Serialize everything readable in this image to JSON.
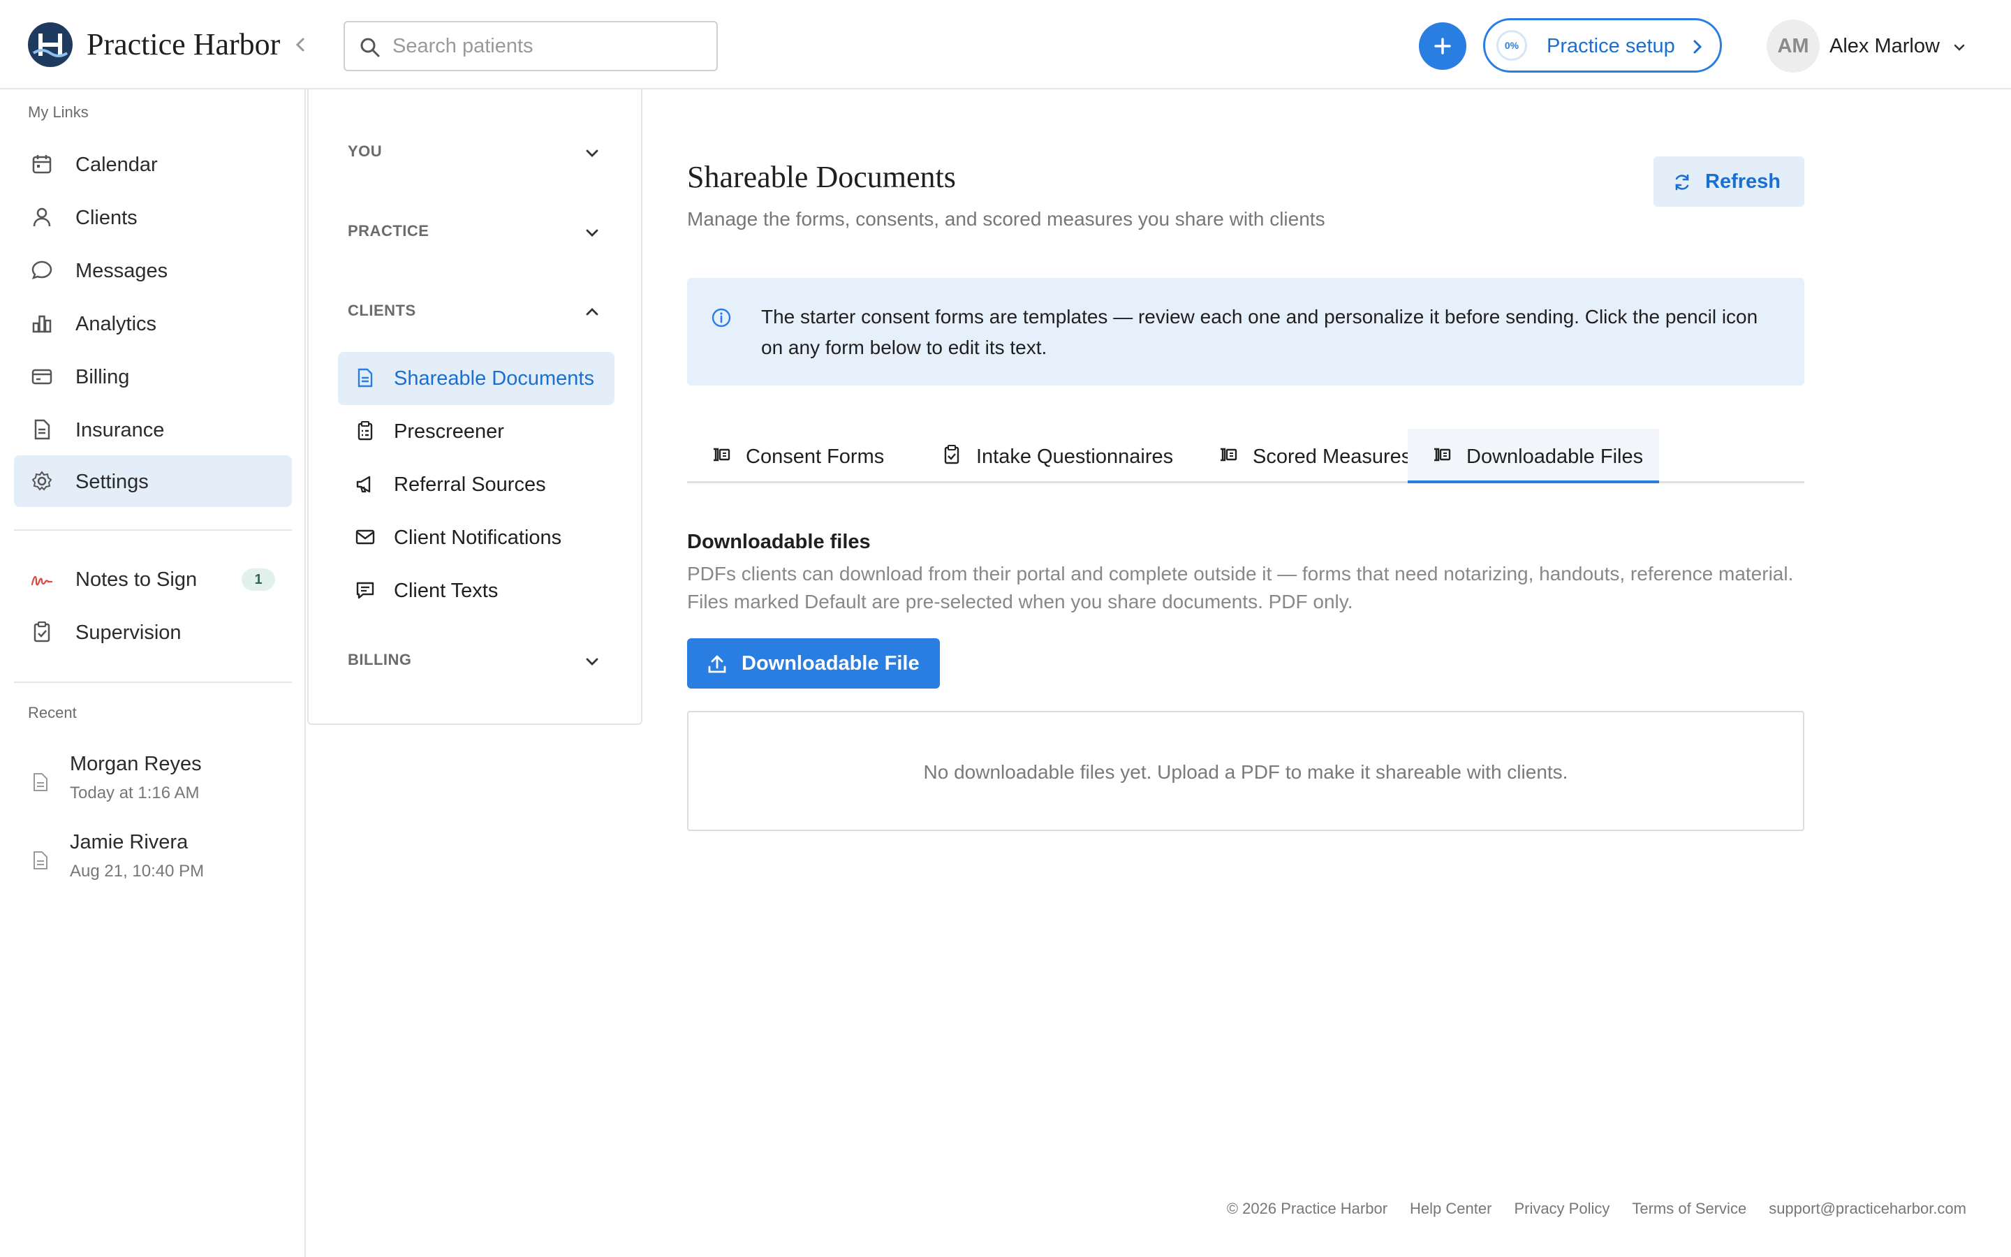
{
  "app": {
    "brand": "Practice Harbor"
  },
  "header": {
    "search_placeholder": "Search patients",
    "setup_progress": "0%",
    "setup_label": "Practice setup",
    "user_initials": "AM",
    "user_name": "Alex Marlow"
  },
  "sidebar": {
    "my_links_heading": "My Links",
    "items": [
      {
        "label": "Calendar",
        "icon": "calendar-icon"
      },
      {
        "label": "Clients",
        "icon": "user-icon"
      },
      {
        "label": "Messages",
        "icon": "chat-bubble-icon"
      },
      {
        "label": "Analytics",
        "icon": "bar-chart-icon"
      },
      {
        "label": "Billing",
        "icon": "credit-card-icon"
      },
      {
        "label": "Insurance",
        "icon": "document-icon"
      },
      {
        "label": "Settings",
        "icon": "gear-icon"
      }
    ],
    "secondary_items": [
      {
        "label": "Notes to Sign",
        "icon": "signature-icon",
        "badge": "1"
      },
      {
        "label": "Supervision",
        "icon": "clipboard-check-icon"
      }
    ],
    "recent_heading": "Recent",
    "recent": [
      {
        "name": "Morgan Reyes",
        "time": "Today at 1:16 AM"
      },
      {
        "name": "Jamie Rivera",
        "time": "Aug 21, 10:40 PM"
      }
    ]
  },
  "subnav": {
    "sections": [
      "YOU",
      "PRACTICE",
      "CLIENTS",
      "BILLING"
    ],
    "client_items": [
      {
        "label": "Shareable Documents",
        "icon": "document-icon"
      },
      {
        "label": "Prescreener",
        "icon": "clipboard-icon"
      },
      {
        "label": "Referral Sources",
        "icon": "megaphone-icon"
      },
      {
        "label": "Client Notifications",
        "icon": "envelope-icon"
      },
      {
        "label": "Client Texts",
        "icon": "message-icon"
      }
    ]
  },
  "main": {
    "title": "Shareable Documents",
    "subtitle": "Manage the forms, consents, and scored measures you share with clients",
    "refresh_label": "Refresh",
    "info_text": "The starter consent forms are templates — review each one and personalize it before sending. Click the pencil icon on any form below to edit its text.",
    "tabs": [
      {
        "label": "Consent Forms",
        "icon": "form-icon"
      },
      {
        "label": "Intake Questionnaires",
        "icon": "clipboard-icon"
      },
      {
        "label": "Scored Measures",
        "icon": "form-icon"
      },
      {
        "label": "Downloadable Files",
        "icon": "form-icon"
      }
    ],
    "active_tab": "Downloadable Files",
    "section_title": "Downloadable files",
    "section_desc": "PDFs clients can download from their portal and complete outside it — forms that need notarizing, handouts, reference material. Files marked Default are pre-selected when you share documents. PDF only.",
    "upload_label": "Downloadable File",
    "empty_text": "No downloadable files yet. Upload a PDF to make it shareable with clients."
  },
  "footer": {
    "copyright": "© 2026 Practice Harbor",
    "help": "Help Center",
    "privacy": "Privacy Policy",
    "terms": "Terms of Service",
    "email": "support@practiceharbor.com"
  },
  "colors": {
    "accent": "#2a7de1",
    "active_bg": "#e3eef9",
    "info_bg": "#e6f0fa",
    "brand_navy": "#1e3a5f"
  }
}
